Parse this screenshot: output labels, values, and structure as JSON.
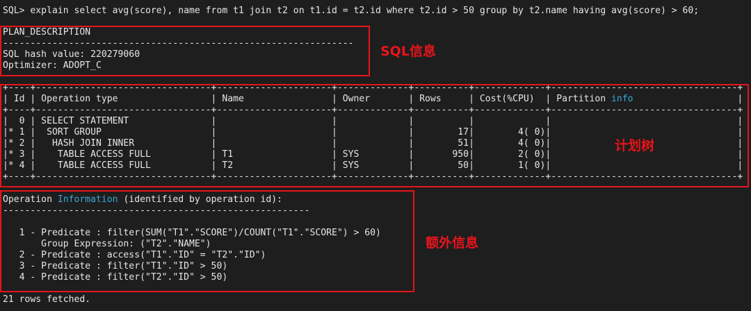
{
  "terminal": {
    "prompt": "SQL> explain select avg(score), name from t1 join t2 on t1.id = t2.id where t2.id > 50 group by t2.name having avg(score) > 60;",
    "plan_section": {
      "header": "PLAN_DESCRIPTION",
      "separator": "----------------------------------------------------------------",
      "hash_line": "SQL hash value: 220279060",
      "optimizer_line": "Optimizer: ADOPT_C"
    },
    "plan_table": {
      "border": "+----+--------------------------------+---------------------+-------------+----------+-------------+----------------------------------+",
      "header_line_a": "| Id | Operation type                 | Name                | Owner       | Rows     | Cost(%CPU)  | Partition ",
      "header_hl": "info",
      "header_line_b": "                   |",
      "rows": [
        "|  0 | SELECT STATEMENT               |                     |             |          |             |                                  |",
        "|* 1 |  SORT GROUP                    |                     |             |        17|        4( 0)|                                  |",
        "|* 2 |   HASH JOIN INNER              |                     |             |        51|        4( 0)|                                  |",
        "|* 3 |    TABLE ACCESS FULL           | T1                  | SYS         |       950|        2( 0)|                                  |",
        "|* 4 |    TABLE ACCESS FULL           | T2                  | SYS         |        50|        1( 0)|                                  |"
      ]
    },
    "op_info": {
      "title_a": "Operation ",
      "title_hl": "Information",
      "title_b": " (identified by operation id):",
      "separator": "--------------------------------------------------------",
      "lines": [
        "   1 - Predicate : filter(SUM(\"T1\".\"SCORE\")/COUNT(\"T1\".\"SCORE\") > 60)",
        "       Group Expression: (\"T2\".\"NAME\")",
        "   2 - Predicate : access(\"T1\".\"ID\" = \"T2\".\"ID\")",
        "   3 - Predicate : filter(\"T1\".\"ID\" > 50)",
        "   4 - Predicate : filter(\"T2\".\"ID\" > 50)"
      ]
    },
    "footer": "21 rows fetched."
  },
  "annotations": {
    "sql_info": "SQL信息",
    "plan_tree": "计划树",
    "extra_info": "额外信息"
  },
  "colors": {
    "background": "#1e1e1e",
    "text": "#e6e6e6",
    "highlight": "#3aa8d8",
    "annotation_red": "#e8141b"
  }
}
